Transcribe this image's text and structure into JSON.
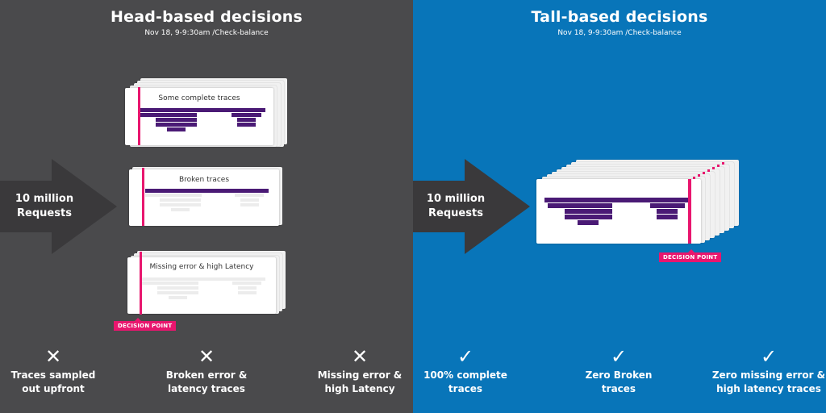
{
  "left": {
    "title": "Head-based decisions",
    "subtitle": "Nov 18, 9-9:30am /Check-balance",
    "arrow_text": [
      "10 million",
      "Requests"
    ],
    "cards": [
      {
        "label": "Some complete traces"
      },
      {
        "label": "Broken traces"
      },
      {
        "label": "Missing error & high Latency"
      }
    ],
    "decision_point": "DECISION POINT",
    "results": [
      {
        "icon": "✕",
        "line1": "Traces sampled",
        "line2": "out upfront"
      },
      {
        "icon": "✕",
        "line1": "Broken error &",
        "line2": "latency traces"
      },
      {
        "icon": "✕",
        "line1": "Missing error &",
        "line2": "high Latency"
      }
    ]
  },
  "right": {
    "title": "Tall-based decisions",
    "subtitle": "Nov 18, 9-9:30am /Check-balance",
    "arrow_text": [
      "10 million",
      "Requests"
    ],
    "decision_point": "DECISION POINT",
    "results": [
      {
        "icon": "✓",
        "line1": "100% complete",
        "line2": "traces"
      },
      {
        "icon": "✓",
        "line1": "Zero Broken",
        "line2": "traces"
      },
      {
        "icon": "✓",
        "line1": "Zero missing error &",
        "line2": "high latency traces"
      }
    ]
  },
  "colors": {
    "left_bg": "#4a4a4c",
    "right_bg": "#0875b9",
    "arrow": "#3a393b",
    "trace_bar": "#4a1a75",
    "decision_point": "#e8166e"
  }
}
